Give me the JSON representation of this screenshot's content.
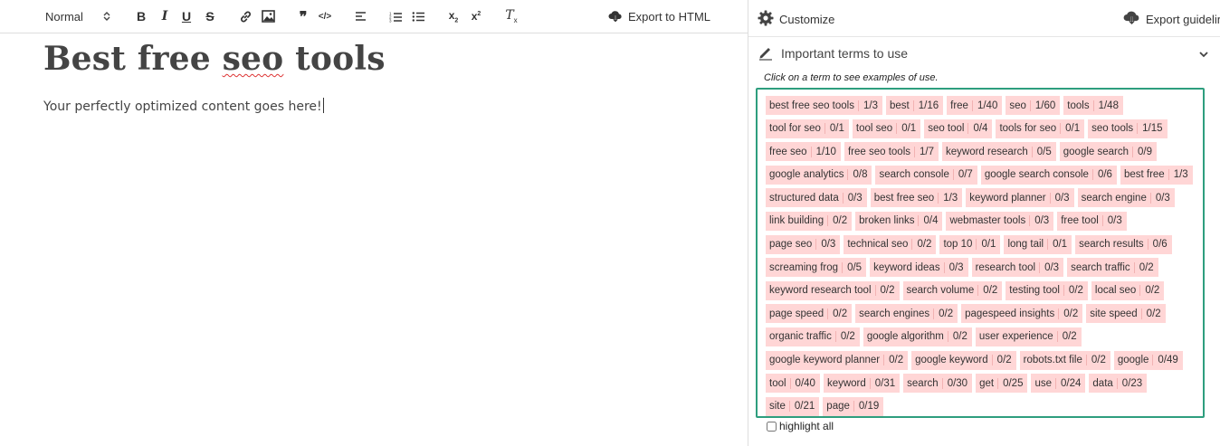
{
  "editor": {
    "toolbar": {
      "format_label": "Normal",
      "export_label": "Export to HTML"
    },
    "title_before": "Best free ",
    "title_spell": "seo",
    "title_after": " tools",
    "body": "Your perfectly optimized content goes here!"
  },
  "sidebar": {
    "customize_label": "Customize",
    "export_guidelines_label": "Export guideline",
    "terms_heading": "Important terms to use",
    "hint": "Click on a term to see examples of use.",
    "highlight_all_label": "highlight all",
    "terms": [
      {
        "term": "best free seo tools",
        "count": "1/3"
      },
      {
        "term": "best",
        "count": "1/16"
      },
      {
        "term": "free",
        "count": "1/40"
      },
      {
        "term": "seo",
        "count": "1/60"
      },
      {
        "term": "tools",
        "count": "1/48"
      },
      {
        "term": "tool for seo",
        "count": "0/1"
      },
      {
        "term": "tool seo",
        "count": "0/1"
      },
      {
        "term": "seo tool",
        "count": "0/4"
      },
      {
        "term": "tools for seo",
        "count": "0/1"
      },
      {
        "term": "seo tools",
        "count": "1/15"
      },
      {
        "term": "free seo",
        "count": "1/10"
      },
      {
        "term": "free seo tools",
        "count": "1/7"
      },
      {
        "term": "keyword research",
        "count": "0/5"
      },
      {
        "term": "google search",
        "count": "0/9"
      },
      {
        "term": "google analytics",
        "count": "0/8"
      },
      {
        "term": "search console",
        "count": "0/7"
      },
      {
        "term": "google search console",
        "count": "0/6"
      },
      {
        "term": "best free",
        "count": "1/3"
      },
      {
        "term": "structured data",
        "count": "0/3"
      },
      {
        "term": "best free seo",
        "count": "1/3"
      },
      {
        "term": "keyword planner",
        "count": "0/3"
      },
      {
        "term": "search engine",
        "count": "0/3"
      },
      {
        "term": "link building",
        "count": "0/2"
      },
      {
        "term": "broken links",
        "count": "0/4"
      },
      {
        "term": "webmaster tools",
        "count": "0/3"
      },
      {
        "term": "free tool",
        "count": "0/3"
      },
      {
        "term": "page seo",
        "count": "0/3"
      },
      {
        "term": "technical seo",
        "count": "0/2"
      },
      {
        "term": "top 10",
        "count": "0/1"
      },
      {
        "term": "long tail",
        "count": "0/1"
      },
      {
        "term": "search results",
        "count": "0/6"
      },
      {
        "term": "screaming frog",
        "count": "0/5"
      },
      {
        "term": "keyword ideas",
        "count": "0/3"
      },
      {
        "term": "research tool",
        "count": "0/3"
      },
      {
        "term": "search traffic",
        "count": "0/2"
      },
      {
        "term": "keyword research tool",
        "count": "0/2"
      },
      {
        "term": "search volume",
        "count": "0/2"
      },
      {
        "term": "testing tool",
        "count": "0/2"
      },
      {
        "term": "local seo",
        "count": "0/2"
      },
      {
        "term": "page speed",
        "count": "0/2"
      },
      {
        "term": "search engines",
        "count": "0/2"
      },
      {
        "term": "pagespeed insights",
        "count": "0/2"
      },
      {
        "term": "site speed",
        "count": "0/2"
      },
      {
        "term": "organic traffic",
        "count": "0/2"
      },
      {
        "term": "google algorithm",
        "count": "0/2"
      },
      {
        "term": "user experience",
        "count": "0/2"
      },
      {
        "term": "google keyword planner",
        "count": "0/2"
      },
      {
        "term": "google keyword",
        "count": "0/2"
      },
      {
        "term": "robots.txt file",
        "count": "0/2"
      },
      {
        "term": "google",
        "count": "0/49"
      },
      {
        "term": "tool",
        "count": "0/40"
      },
      {
        "term": "keyword",
        "count": "0/31"
      },
      {
        "term": "search",
        "count": "0/30"
      },
      {
        "term": "get",
        "count": "0/25"
      },
      {
        "term": "use",
        "count": "0/24"
      },
      {
        "term": "data",
        "count": "0/23"
      },
      {
        "term": "site",
        "count": "0/21"
      },
      {
        "term": "page",
        "count": "0/19"
      }
    ]
  }
}
